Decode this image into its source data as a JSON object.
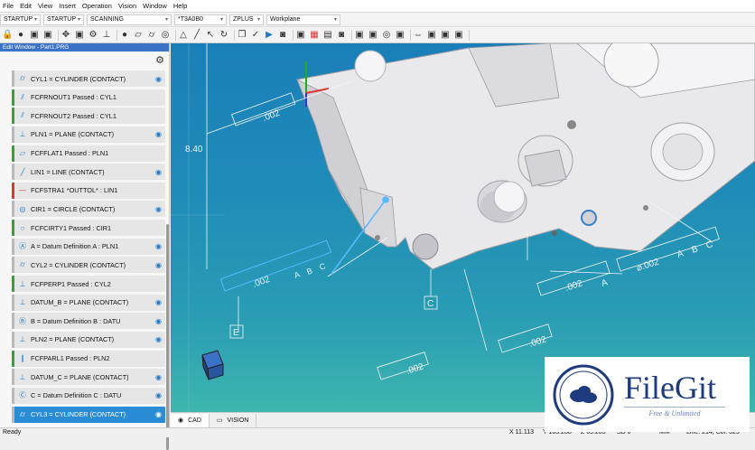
{
  "menu": [
    "File",
    "Edit",
    "View",
    "Insert",
    "Operation",
    "Vision",
    "Window",
    "Help"
  ],
  "toolbar1": {
    "startup1": "STARTUP",
    "startup2": "STARTUP",
    "scanning": "SCANNING",
    "probe": "*T3A0B0",
    "zplus": "ZPLUS",
    "workplane": "Workplane"
  },
  "toolbar2_icons": [
    "lock-icon",
    "sphere-icon",
    "cube-icon",
    "cube-icon",
    "move-icon",
    "cube-icon",
    "gear-icon",
    "probe-icon",
    "sphere-icon",
    "plane-icon",
    "cylinder-icon",
    "circle-icon",
    "cone-icon",
    "line-icon",
    "pointer-icon",
    "rotate-icon",
    "copy-icon",
    "checkmark-icon",
    "play-icon",
    "camera-icon",
    "cube-icon",
    "color-icon",
    "grid-icon",
    "camera-icon",
    "cube-icon",
    "cube-icon",
    "target-icon",
    "cube-icon",
    "arrows-icon",
    "cube-icon",
    "cube-icon",
    "cube-icon"
  ],
  "edit_window": {
    "title": "Edit Window - Part1.PRG",
    "items": [
      {
        "label": "CYL1 = CYLINDER (CONTACT)",
        "icon": "⌭",
        "bar": "#b9b9b9",
        "eye": true
      },
      {
        "label": "FCFRNOUT1 Passed : CYL1",
        "icon": "⫽",
        "bar": "#3a9d3a",
        "eye": false
      },
      {
        "label": "FCFRNOUT2 Passed : CYL1",
        "icon": "⫽",
        "bar": "#3a9d3a",
        "eye": false
      },
      {
        "label": "PLN1 = PLANE (CONTACT)",
        "icon": "⊥",
        "bar": "#b9b9b9",
        "eye": true
      },
      {
        "label": "FCFFLAT1 Passed : PLN1",
        "icon": "▱",
        "bar": "#3a9d3a",
        "eye": false
      },
      {
        "label": "LIN1 = LINE (CONTACT)",
        "icon": "╱",
        "bar": "#b9b9b9",
        "eye": true
      },
      {
        "label": "FCFSTRA1 *OUTTOL* : LIN1",
        "icon": "—",
        "bar": "#d43a2f",
        "eye": false
      },
      {
        "label": "CIR1 = CIRCLE (CONTACT)",
        "icon": "◎",
        "bar": "#b9b9b9",
        "eye": true
      },
      {
        "label": "FCFCIRTY1 Passed : CIR1",
        "icon": "○",
        "bar": "#3a9d3a",
        "eye": false
      },
      {
        "label": "A = Datum Definition A : PLN1",
        "icon": "Ⓐ",
        "bar": "#b9b9b9",
        "eye": true
      },
      {
        "label": "CYL2 = CYLINDER (CONTACT)",
        "icon": "⌭",
        "bar": "#b9b9b9",
        "eye": true
      },
      {
        "label": "FCFPERP1 Passed : CYL2",
        "icon": "⊥",
        "bar": "#3a9d3a",
        "eye": false
      },
      {
        "label": "DATUM_B = PLANE (CONTACT)",
        "icon": "⊥",
        "bar": "#b9b9b9",
        "eye": true
      },
      {
        "label": "B = Datum Definition B : DATU",
        "icon": "Ⓑ",
        "bar": "#b9b9b9",
        "eye": true
      },
      {
        "label": "PLN2 = PLANE (CONTACT)",
        "icon": "⊥",
        "bar": "#b9b9b9",
        "eye": true
      },
      {
        "label": "FCFPARL1 Passed : PLN2",
        "icon": "∥",
        "bar": "#3a9d3a",
        "eye": false
      },
      {
        "label": "DATUM_C = PLANE (CONTACT)",
        "icon": "⊥",
        "bar": "#b9b9b9",
        "eye": true
      },
      {
        "label": "C = Datum Definition C : DATU",
        "icon": "Ⓒ",
        "bar": "#b9b9b9",
        "eye": true
      },
      {
        "label": "CYL3 = CYLINDER (CONTACT)",
        "icon": "⌭",
        "bar": "#b9b9b9",
        "eye": true,
        "selected": true
      }
    ]
  },
  "viewport": {
    "dim_840": "8.40",
    "fcf_left": ".002",
    "fcf_a": "A",
    "fcf_b": "B",
    "fcf_c": "C",
    "fcf_top": ".002",
    "fcf_perp": ".002",
    "fcf_perp_a": "A",
    "fcf_pos": "⌀.002",
    "fcf_pos_a": "A",
    "fcf_pos_b": "B",
    "fcf_pos_c": "C",
    "circ": ".002",
    "par": ".002",
    "datum_e": "E",
    "datum_c": "C",
    "datum_d": "D"
  },
  "tabs": {
    "cad": "CAD",
    "vision": "VISION"
  },
  "status": {
    "ready": "Ready",
    "x": "X 11.113",
    "y": "Y 103.288",
    "z": "Z 69.203",
    "sd": "SD 0",
    "mm": "MM",
    "line": "Line: 214, Col: 025"
  },
  "watermark": {
    "name": "FileGit",
    "tagline": "Free & Unlimited"
  }
}
